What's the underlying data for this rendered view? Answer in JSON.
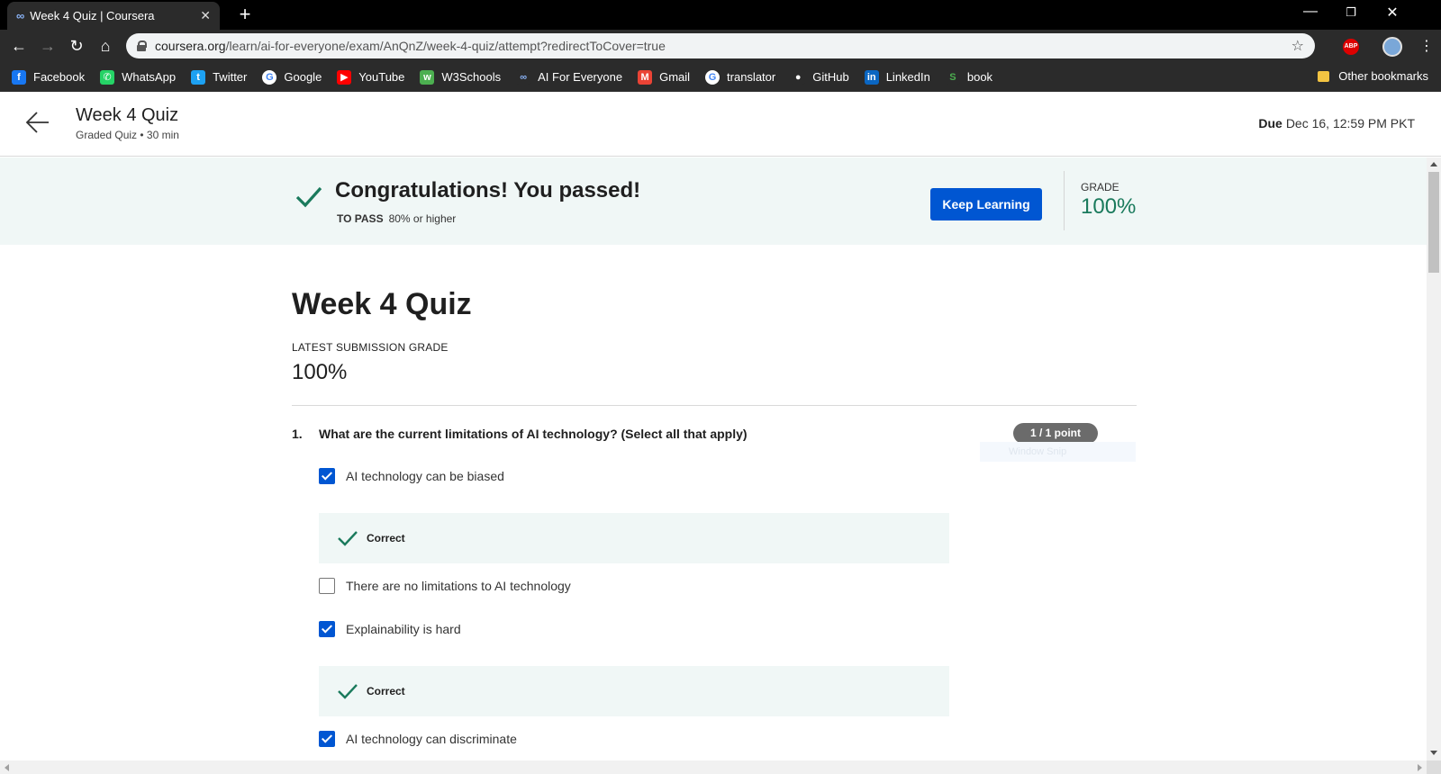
{
  "browser": {
    "tab_title": "Week 4 Quiz | Coursera",
    "tab_icon": "coursera-infinity-icon",
    "new_tab": "+",
    "url_host": "coursera.org",
    "url_path": "/learn/ai-for-everyone/exam/AnQnZ/week-4-quiz/attempt?redirectToCover=true",
    "abp_label": "ABP",
    "bookmarks": [
      {
        "label": "Facebook",
        "icon": "facebook-icon",
        "glyph": "f",
        "color": "#1877f2"
      },
      {
        "label": "WhatsApp",
        "icon": "whatsapp-icon",
        "glyph": "✆",
        "color": "#25d366"
      },
      {
        "label": "Twitter",
        "icon": "twitter-icon",
        "glyph": "t",
        "color": "#1da1f2"
      },
      {
        "label": "Google",
        "icon": "google-icon",
        "glyph": "G",
        "color": "#ffffff"
      },
      {
        "label": "YouTube",
        "icon": "youtube-icon",
        "glyph": "▶",
        "color": "#ff0000"
      },
      {
        "label": "W3Schools",
        "icon": "w3schools-icon",
        "glyph": "w",
        "color": "#4caf50"
      },
      {
        "label": "AI For Everyone",
        "icon": "coursera-infinity-icon",
        "glyph": "∞",
        "color": "#2b2b2b"
      },
      {
        "label": "Gmail",
        "icon": "gmail-icon",
        "glyph": "M",
        "color": "#ea4335"
      },
      {
        "label": "translator",
        "icon": "google-icon",
        "glyph": "G",
        "color": "#ffffff"
      },
      {
        "label": "GitHub",
        "icon": "github-icon",
        "glyph": "●",
        "color": "#2b2b2b"
      },
      {
        "label": "LinkedIn",
        "icon": "linkedin-icon",
        "glyph": "in",
        "color": "#0a66c2"
      },
      {
        "label": "book",
        "icon": "book-s-icon",
        "glyph": "S",
        "color": "#2b2b2b"
      }
    ],
    "other_bookmarks": "Other bookmarks"
  },
  "header": {
    "title": "Week 4 Quiz",
    "subtitle": "Graded Quiz • 30 min",
    "due_label": "Due",
    "due_value": "Dec 16, 12:59 PM PKT"
  },
  "banner": {
    "message": "Congratulations! You passed!",
    "to_pass_label": "TO PASS",
    "to_pass_value": "80% or higher",
    "button": "Keep Learning",
    "grade_label": "GRADE",
    "grade_value": "100%"
  },
  "quiz": {
    "title": "Week 4 Quiz",
    "latest_label": "LATEST SUBMISSION GRADE",
    "latest_value": "100%",
    "question": {
      "number": "1.",
      "text": "What are the current limitations of AI technology? (Select all that apply)",
      "points": "1 / 1 point",
      "ghost_text": "Window Snip",
      "options": [
        {
          "label": "AI technology can be biased",
          "checked": true
        },
        {
          "label": "There are no limitations to AI technology",
          "checked": false
        },
        {
          "label": "Explainability is hard",
          "checked": true
        },
        {
          "label": "AI technology can discriminate",
          "checked": true
        }
      ],
      "feedback": [
        "Correct",
        "Correct"
      ]
    }
  },
  "colors": {
    "primary_blue": "#0056d2",
    "success_green": "#1a7a5c",
    "banner_bg": "#f0f7f6"
  }
}
